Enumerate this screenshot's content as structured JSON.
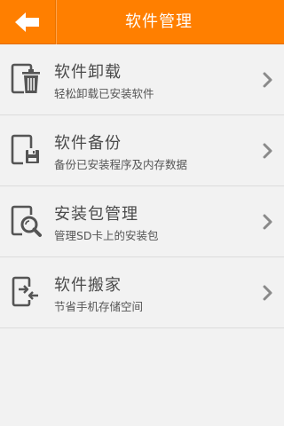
{
  "header": {
    "title": "软件管理",
    "back_icon": "arrow-left-icon",
    "background": "#ff7f00"
  },
  "menu": {
    "items": [
      {
        "icon": "trash-icon",
        "title": "软件卸载",
        "subtitle": "轻松卸载已安装软件"
      },
      {
        "icon": "backup-icon",
        "title": "软件备份",
        "subtitle": "备份已安装程序及内存数据"
      },
      {
        "icon": "package-search-icon",
        "title": "安装包管理",
        "subtitle": "管理SD卡上的安装包"
      },
      {
        "icon": "move-icon",
        "title": "软件搬家",
        "subtitle": "节省手机存储空间"
      }
    ],
    "chevron_icon": "chevron-right-icon"
  }
}
